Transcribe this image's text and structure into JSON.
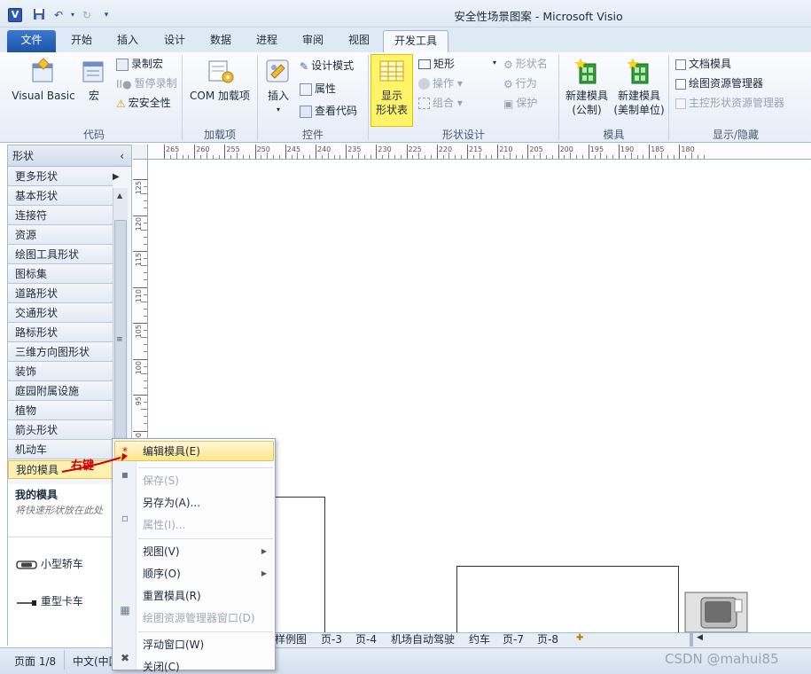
{
  "window": {
    "title": "安全性场景图案 - Microsoft Visio"
  },
  "tabs": [
    "文件",
    "开始",
    "插入",
    "设计",
    "数据",
    "进程",
    "审阅",
    "视图",
    "开发工具"
  ],
  "ribbon": {
    "code": {
      "label": "代码",
      "vba": "Visual Basic",
      "macro": "宏",
      "record": "录制宏",
      "pause": "暂停录制",
      "security": "宏安全性"
    },
    "addins": {
      "label": "加载项",
      "com": "COM 加载项"
    },
    "controls": {
      "label": "控件",
      "insert": "插入",
      "design_mode": "设计模式",
      "properties": "属性",
      "view_code": "查看代码"
    },
    "shape_design": {
      "label": "形状设计",
      "show_line1": "显示",
      "show_line2": "形状表",
      "rect": "矩形",
      "operation": "操作",
      "group": "组合",
      "shape_name": "形状名",
      "behavior": "行为",
      "protect": "保护"
    },
    "stencil": {
      "label": "模具",
      "new_metric_1": "新建模具",
      "new_metric_2": "(公制)",
      "new_us_1": "新建模具",
      "new_us_2": "(美制单位)"
    },
    "show_hide": {
      "label": "显示/隐藏",
      "doc_stencil": "文档模具",
      "drawing_explorer": "绘图资源管理器",
      "master_explorer": "主控形状资源管理器"
    }
  },
  "shapes_pane": {
    "title": "形状",
    "collapse_icon": "‹",
    "stencils": [
      "更多形状",
      "基本形状",
      "连接符",
      "资源",
      "绘图工具形状",
      "图标集",
      "道路形状",
      "交通形状",
      "路标形状",
      "三维方向图形状",
      "装饰",
      "庭园附属设施",
      "植物",
      "箭头形状",
      "机动车",
      "我的模具"
    ],
    "my_stencil_title": "我的模具",
    "my_stencil_hint": "将快速形状放在此处",
    "shapes": [
      "小型轿车",
      "重型卡车"
    ]
  },
  "annotation": {
    "text": "右键",
    "color": "#cc0000"
  },
  "ruler": {
    "top": [
      "265",
      "260",
      "255",
      "250",
      "245",
      "240",
      "235",
      "230",
      "225",
      "220",
      "215",
      "210",
      "205",
      "200",
      "195",
      "190",
      "185",
      "180"
    ],
    "left": [
      "125",
      "120",
      "115",
      "110",
      "105",
      "100",
      "95",
      "90"
    ]
  },
  "page_tabs": [
    "样例图",
    "页-3",
    "页-4",
    "机场自动驾驶",
    "约车",
    "页-7",
    "页-8"
  ],
  "status": {
    "page": "页面 1/8",
    "lang": "中文(中国)"
  },
  "watermark": "CSDN @mahui85",
  "context_menu": [
    {
      "label": "编辑模具(E)",
      "enabled": true,
      "highlight": true
    },
    {
      "sep": true
    },
    {
      "label": "保存(S)",
      "enabled": false
    },
    {
      "label": "另存为(A)...",
      "enabled": true
    },
    {
      "label": "属性(I)...",
      "enabled": false
    },
    {
      "sep": true
    },
    {
      "label": "视图(V)",
      "enabled": true,
      "submenu": true
    },
    {
      "label": "顺序(O)",
      "enabled": true,
      "submenu": true
    },
    {
      "label": "重置模具(R)",
      "enabled": true
    },
    {
      "label": "绘图资源管理器窗口(D)",
      "enabled": false
    },
    {
      "sep": true
    },
    {
      "label": "浮动窗口(W)",
      "enabled": true
    },
    {
      "label": "关闭(C)",
      "enabled": true
    }
  ],
  "colors": {
    "accent": "#1e55a8",
    "highlight": "#fff36a"
  }
}
